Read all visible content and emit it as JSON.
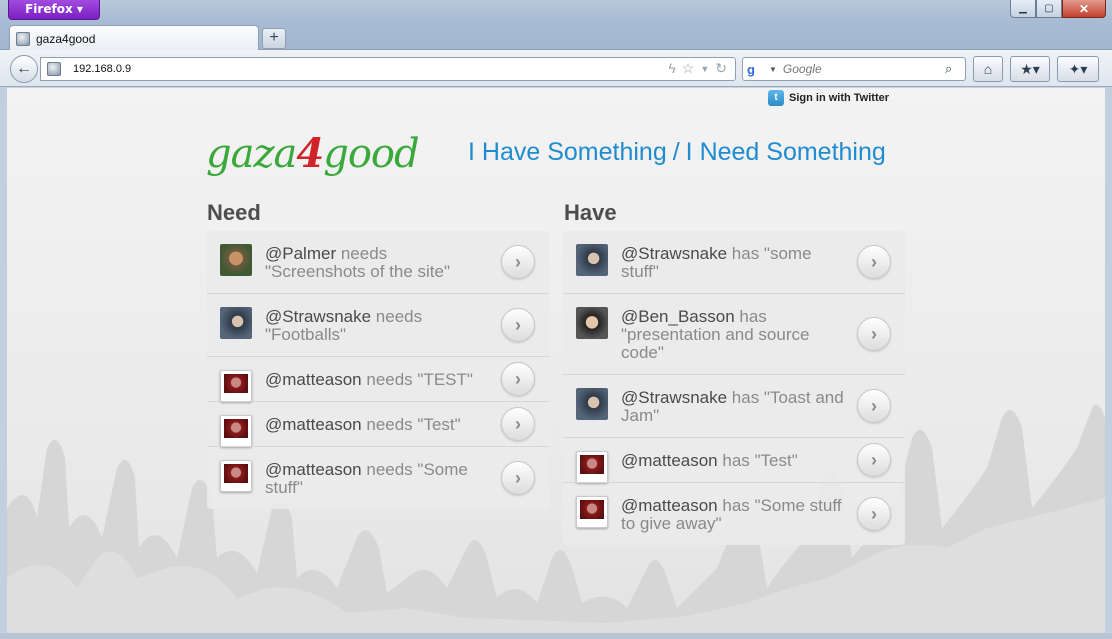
{
  "browser": {
    "menu_label": "Firefox ▾",
    "tab_title": "gaza4good",
    "new_tab_label": "+",
    "url": "192.168.0.9",
    "search_placeholder": "Google",
    "window_controls": [
      "minimize-icon",
      "restore-icon",
      "close-icon"
    ]
  },
  "page": {
    "signin_label": "Sign in with Twitter",
    "logo": {
      "part1": "gaza",
      "part2": "4",
      "part3": "good"
    },
    "have_link": "I Have Something",
    "separator": "/",
    "need_link": "I Need Something",
    "need_title": "Need",
    "have_title": "Have",
    "need_items": [
      {
        "user": "@Palmer",
        "text": " needs \"Screenshots of the site\"",
        "avatar": "palmer"
      },
      {
        "user": "@Strawsnake",
        "text": " needs \"Footballs\"",
        "avatar": "straw"
      },
      {
        "user": "@matteason",
        "text": " needs \"TEST\"",
        "avatar": "matte"
      },
      {
        "user": "@matteason",
        "text": " needs \"Test\"",
        "avatar": "matte"
      },
      {
        "user": "@matteason",
        "text": " needs \"Some stuff\"",
        "avatar": "matte"
      }
    ],
    "have_items": [
      {
        "user": "@Strawsnake",
        "text": " has \"some stuff\"",
        "avatar": "straw"
      },
      {
        "user": "@Ben_Basson",
        "text": " has \"presentation and source code\"",
        "avatar": "ben"
      },
      {
        "user": "@Strawsnake",
        "text": " has \"Toast and Jam\"",
        "avatar": "straw"
      },
      {
        "user": "@matteason",
        "text": " has \"Test\"",
        "avatar": "matte"
      },
      {
        "user": "@matteason",
        "text": " has \"Some stuff to give away\"",
        "avatar": "matte"
      }
    ]
  },
  "colors": {
    "link_blue": "#1f8bd0",
    "logo_green": "#3aa83a",
    "logo_red": "#d1232a",
    "firefox_purple": "#7b20c2"
  }
}
